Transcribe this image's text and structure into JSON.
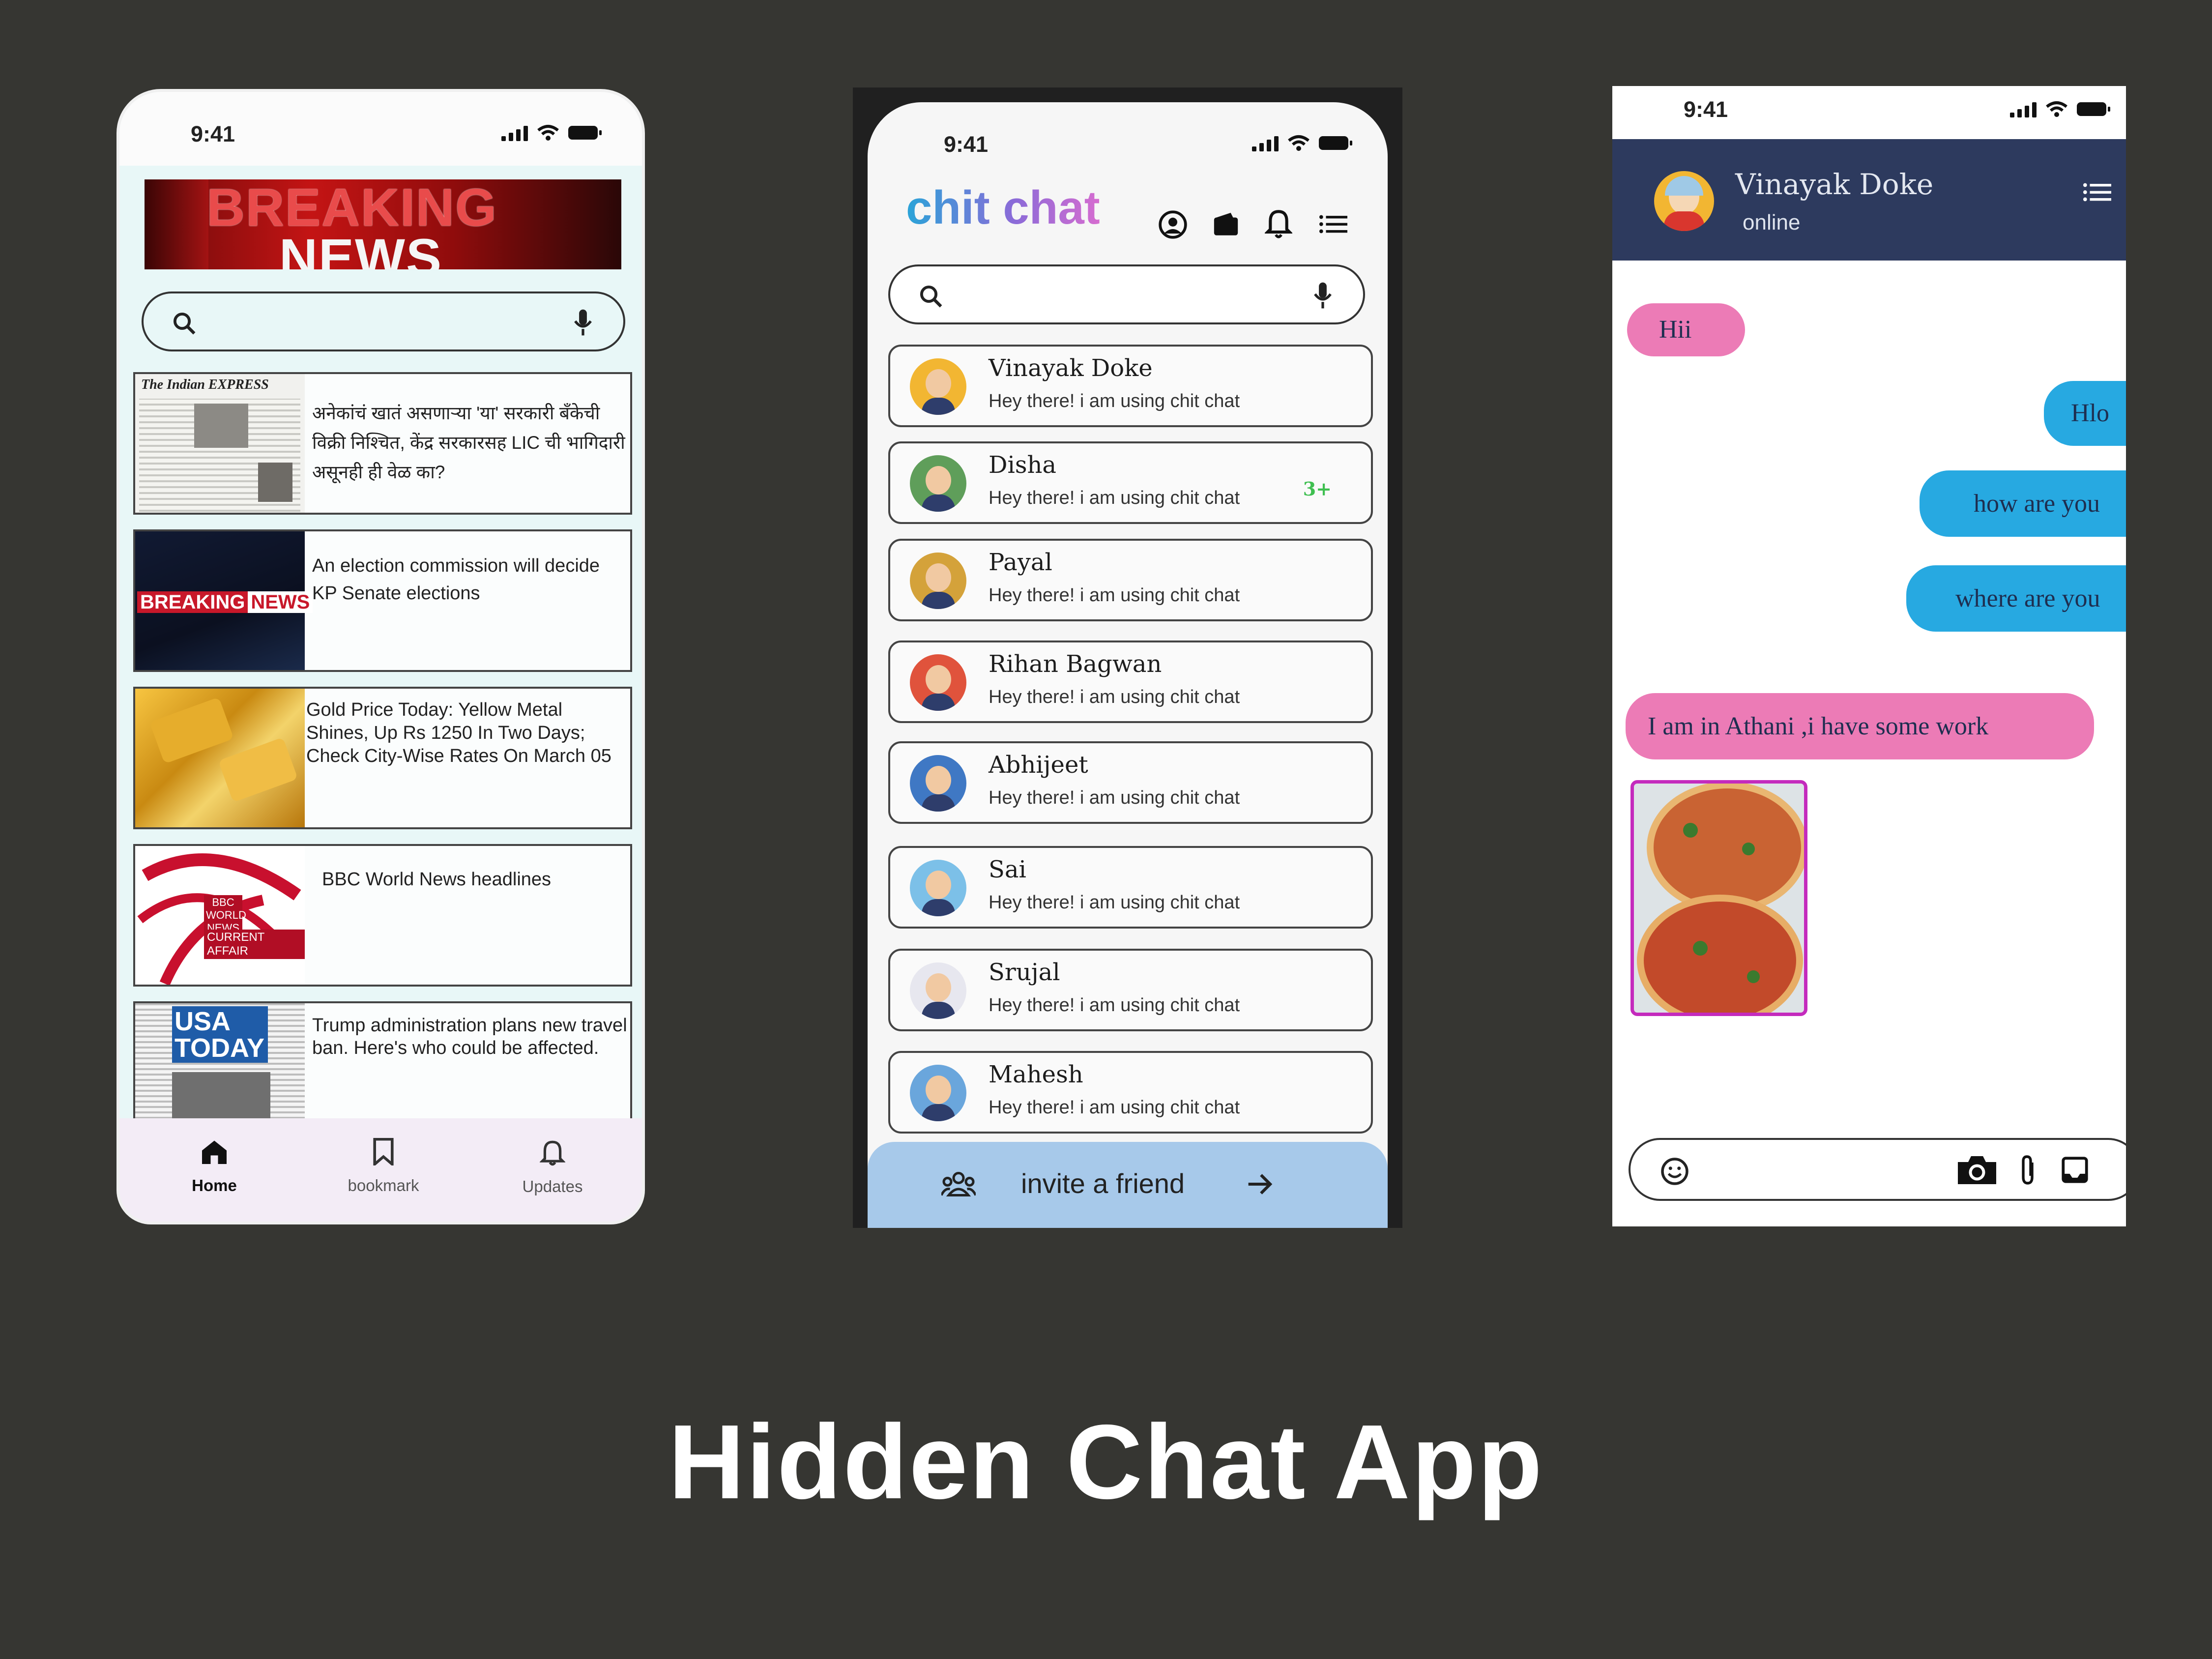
{
  "news_app": {
    "status_time": "9:41",
    "banner": {
      "line1": "BREAKING",
      "line2": "NEWS"
    },
    "items": [
      {
        "source": "The Indian EXPRESS",
        "headline": "अनेकांचं खातं असणाऱ्या 'या' सरकारी बँकेची विक्री निश्चित, केंद्र सरकारसह LIC ची भागिदारी असूनही ही वेळ का?"
      },
      {
        "thumb_label_1": "BREAKING",
        "thumb_label_2": "NEWS",
        "headline": "An election commission will decide KP Senate elections"
      },
      {
        "headline": "Gold Price Today: Yellow Metal Shines, Up Rs 1250 In Two Days; Check City-Wise Rates On March 05"
      },
      {
        "thumb_label": "BBC WORLD NEWS",
        "thumb_label_2": "CURRENT AFFAIR",
        "headline": "BBC World News headlines"
      },
      {
        "thumb_label": "USA TODAY",
        "headline": "Trump administration plans new travel ban. Here's who could be affected."
      }
    ],
    "nav": [
      {
        "label": "Home",
        "icon": "home-icon",
        "active": true
      },
      {
        "label": "bookmark",
        "icon": "bookmark-icon",
        "active": false
      },
      {
        "label": "Updates",
        "icon": "bell-icon",
        "active": false
      }
    ]
  },
  "chat_list_app": {
    "status_time": "9:41",
    "logo": "chit chat",
    "contacts": [
      {
        "name": "Vinayak Doke",
        "status": "Hey there! i am using chit chat",
        "badge": "",
        "color": "#f2b632"
      },
      {
        "name": "Disha",
        "status": "Hey there! i am using chit chat",
        "badge": "3+",
        "color": "#5f9e5a"
      },
      {
        "name": "Payal",
        "status": "Hey there! i am using chit chat",
        "badge": "",
        "color": "#d4a23a"
      },
      {
        "name": "Rihan Bagwan",
        "status": "Hey there! i am using chit chat",
        "badge": "",
        "color": "#e0533c"
      },
      {
        "name": "Abhijeet",
        "status": "Hey there! i am using chit chat",
        "badge": "",
        "color": "#3f78c4"
      },
      {
        "name": "Sai",
        "status": "Hey there! i am using chit chat",
        "badge": "",
        "color": "#7cc0e8"
      },
      {
        "name": "Srujal",
        "status": "Hey there! i am using chit chat",
        "badge": "",
        "color": "#e7e7ef"
      },
      {
        "name": "Mahesh",
        "status": "Hey there! i am using chit chat",
        "badge": "",
        "color": "#6aa6dc"
      }
    ],
    "invite_label": "invite a friend"
  },
  "conversation_app": {
    "status_time": "9:41",
    "contact_name": "Vinayak Doke",
    "contact_status": "online",
    "messages": [
      {
        "text": "Hii",
        "side": "left"
      },
      {
        "text": "Hlo",
        "side": "right"
      },
      {
        "text": "how are you",
        "side": "right"
      },
      {
        "text": "where are you",
        "side": "right"
      },
      {
        "text": "I am in Athani ,i have some work",
        "side": "left"
      }
    ]
  },
  "page_title": "Hidden Chat App"
}
